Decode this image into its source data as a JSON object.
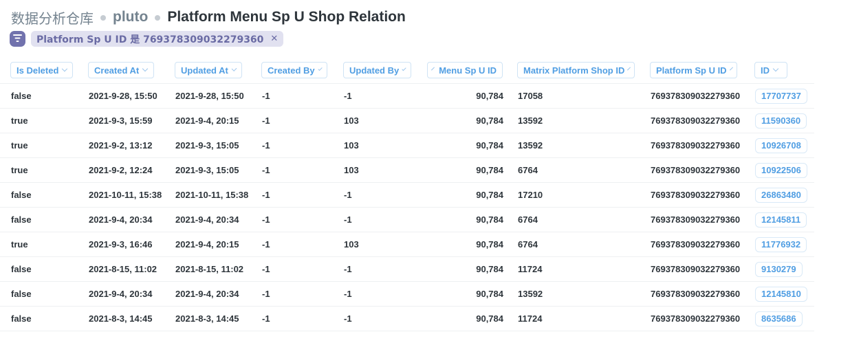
{
  "breadcrumb": {
    "database": "数据分析仓库",
    "schema": "pluto",
    "table": "Platform Menu Sp U Shop Relation"
  },
  "filter": {
    "label": "Platform Sp U ID 是 769378309032279360",
    "close": "✕"
  },
  "columns": [
    {
      "key": "is_deleted",
      "label": "Is Deleted"
    },
    {
      "key": "created_at",
      "label": "Created At"
    },
    {
      "key": "updated_at",
      "label": "Updated At"
    },
    {
      "key": "created_by",
      "label": "Created By"
    },
    {
      "key": "updated_by",
      "label": "Updated By"
    },
    {
      "key": "menu_sp_u_id",
      "label": "Menu Sp U ID"
    },
    {
      "key": "matrix_platform_shop_id",
      "label": "Matrix Platform Shop ID"
    },
    {
      "key": "platform_sp_u_id",
      "label": "Platform Sp U ID"
    },
    {
      "key": "id",
      "label": "ID"
    }
  ],
  "rows": [
    [
      "false",
      "2021-9-28, 15:50",
      "2021-9-28, 15:50",
      "-1",
      "-1",
      "90,784",
      "17058",
      "769378309032279360",
      "17707737"
    ],
    [
      "true",
      "2021-9-3, 15:59",
      "2021-9-4, 20:15",
      "-1",
      "103",
      "90,784",
      "13592",
      "769378309032279360",
      "11590360"
    ],
    [
      "true",
      "2021-9-2, 13:12",
      "2021-9-3, 15:05",
      "-1",
      "103",
      "90,784",
      "13592",
      "769378309032279360",
      "10926708"
    ],
    [
      "true",
      "2021-9-2, 12:24",
      "2021-9-3, 15:05",
      "-1",
      "103",
      "90,784",
      "6764",
      "769378309032279360",
      "10922506"
    ],
    [
      "false",
      "2021-10-11, 15:38",
      "2021-10-11, 15:38",
      "-1",
      "-1",
      "90,784",
      "17210",
      "769378309032279360",
      "26863480"
    ],
    [
      "false",
      "2021-9-4, 20:34",
      "2021-9-4, 20:34",
      "-1",
      "-1",
      "90,784",
      "6764",
      "769378309032279360",
      "12145811"
    ],
    [
      "true",
      "2021-9-3, 16:46",
      "2021-9-4, 20:15",
      "-1",
      "103",
      "90,784",
      "6764",
      "769378309032279360",
      "11776932"
    ],
    [
      "false",
      "2021-8-15, 11:02",
      "2021-8-15, 11:02",
      "-1",
      "-1",
      "90,784",
      "11724",
      "769378309032279360",
      "9130279"
    ],
    [
      "false",
      "2021-9-4, 20:34",
      "2021-9-4, 20:34",
      "-1",
      "-1",
      "90,784",
      "13592",
      "769378309032279360",
      "12145810"
    ],
    [
      "false",
      "2021-8-3, 14:45",
      "2021-8-3, 14:45",
      "-1",
      "-1",
      "90,784",
      "11724",
      "769378309032279360",
      "8635686"
    ]
  ],
  "colors": {
    "brand": "#509ee3",
    "filter_accent": "#7172ad",
    "text": "#2e353b"
  },
  "icons": {
    "filter_toggle": "filter-icon",
    "sort": "chevron-down-icon"
  }
}
